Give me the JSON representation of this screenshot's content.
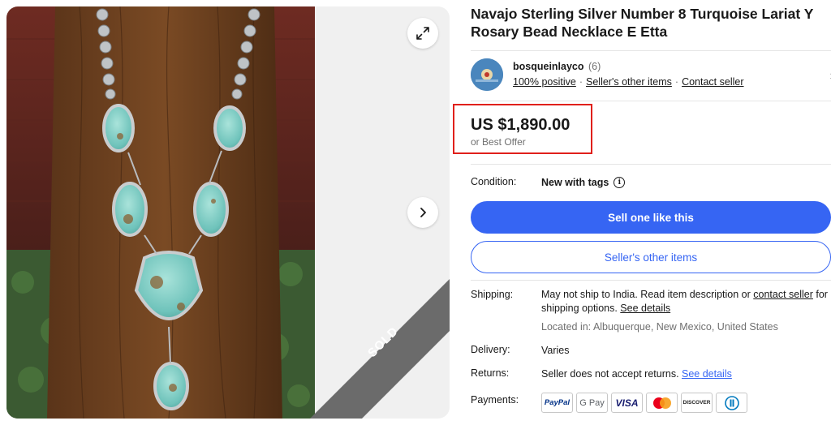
{
  "listing": {
    "title": "Navajo Sterling Silver Number 8 Turquoise Lariat Y Rosary Bead Necklace E Etta",
    "sold_badge": "SOLD"
  },
  "seller": {
    "name": "bosqueinlayco",
    "feedback_count": "(6)",
    "positive": "100% positive",
    "other_items": "Seller's other items",
    "contact": "Contact seller"
  },
  "price": {
    "amount": "US $1,890.00",
    "best_offer": "or Best Offer"
  },
  "condition": {
    "label": "Condition:",
    "value": "New with tags"
  },
  "actions": {
    "sell_one": "Sell one like this",
    "other_items": "Seller's other items"
  },
  "shipping": {
    "label": "Shipping:",
    "text_a": "May not ship to India. Read item description or ",
    "contact_link": "contact seller",
    "text_b": " for shipping options. ",
    "details_link": "See details",
    "location": "Located in: Albuquerque, New Mexico, United States"
  },
  "delivery": {
    "label": "Delivery:",
    "value": "Varies"
  },
  "returns": {
    "label": "Returns:",
    "text": "Seller does not accept returns. ",
    "details_link": "See details"
  },
  "payments": {
    "label": "Payments:",
    "methods": [
      "PayPal",
      "G Pay",
      "VISA",
      "",
      "DISCOVER",
      ""
    ]
  },
  "icons": [
    "expand-icon",
    "chevron-right-icon",
    "info-icon",
    "mastercard-logo",
    "diners-club-logo"
  ]
}
